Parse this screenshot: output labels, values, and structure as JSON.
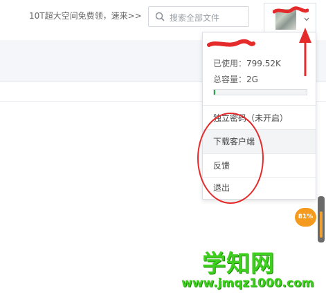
{
  "header": {
    "promo_text": "10T超大空间免费领，速来>>",
    "search_placeholder": "搜索全部文件"
  },
  "dropdown": {
    "used_label": "已使用：",
    "used_value": "799.52K",
    "total_label": "总容量：",
    "total_value": "2G",
    "usage_fraction": 0.015,
    "items": [
      {
        "label": "独立密码（未开启）"
      },
      {
        "label": "下载客户端"
      },
      {
        "label": "反馈"
      },
      {
        "label": "退出"
      }
    ]
  },
  "badge": {
    "text": "81%"
  },
  "watermark": {
    "main": "学知网",
    "url": "www.jmqz1000.com"
  },
  "colors": {
    "progress_fill": "#27a844",
    "annotation_red": "#e42a2a",
    "badge_orange": "#f39a1f",
    "watermark_green": "#3fcf1f"
  }
}
